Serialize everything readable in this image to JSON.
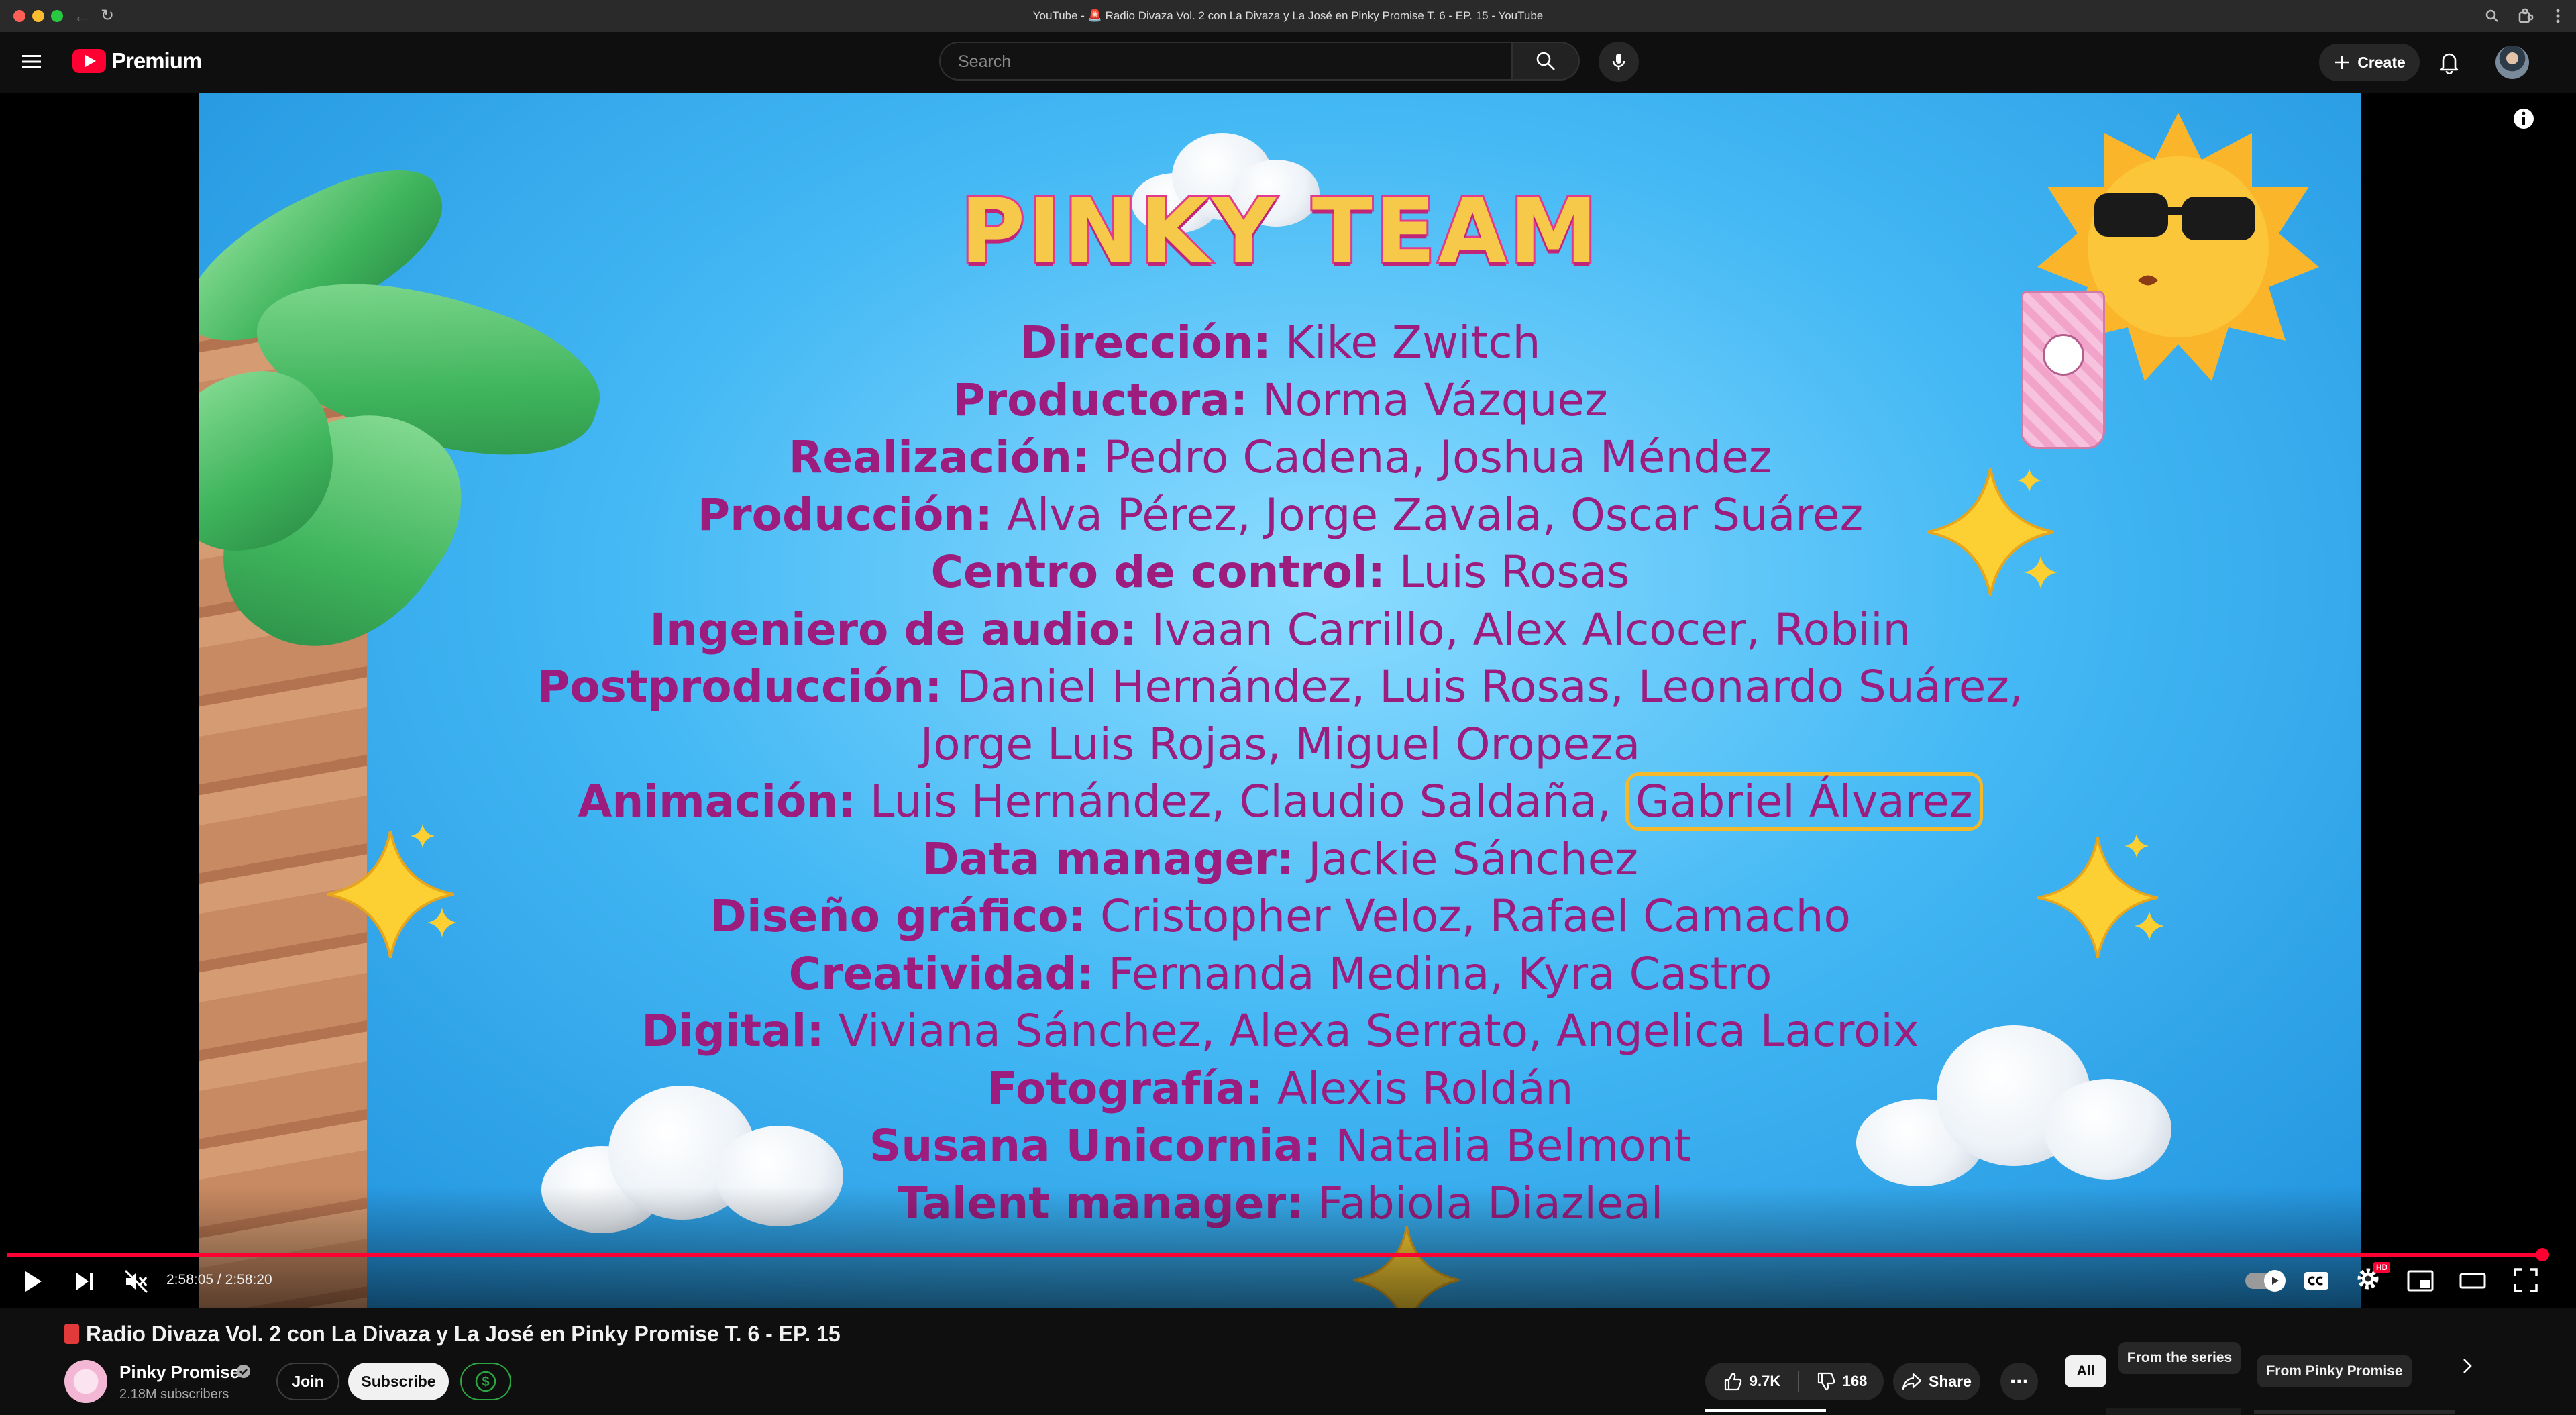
{
  "browser": {
    "window_title": "YouTube - 🚨 Radio Divaza Vol. 2 con La Divaza y La José en Pinky Promise T. 6 - EP. 15 - YouTube",
    "back_glyph": "←",
    "reload_glyph": "↻"
  },
  "header": {
    "logo_text": "Premium",
    "search_placeholder": "Search",
    "create_label": "Create"
  },
  "video": {
    "frame": {
      "title": "PINKY TEAM",
      "credits": [
        {
          "role": "Dirección:",
          "names": "Kike Zwitch"
        },
        {
          "role": "Productora:",
          "names": "Norma Vázquez"
        },
        {
          "role": "Realización:",
          "names": "Pedro Cadena, Joshua Méndez"
        },
        {
          "role": "Producción:",
          "names": "Alva Pérez, Jorge Zavala, Oscar Suárez"
        },
        {
          "role": "Centro de control:",
          "names": "Luis Rosas"
        },
        {
          "role": "Ingeniero de audio:",
          "names": "Ivaan Carrillo, Alex Alcocer, Robiin"
        },
        {
          "role": "Postproducción:",
          "names": "Daniel Hernández, Luis Rosas, Leonardo Suárez,"
        },
        {
          "role": "",
          "names": "Jorge Luis Rojas, Miguel Oropeza"
        },
        {
          "role": "Animación:",
          "names": "Luis Hernández, Claudio Saldaña,",
          "highlighted": "Gabriel Álvarez"
        },
        {
          "role": "Data manager:",
          "names": "Jackie Sánchez"
        },
        {
          "role": "Diseño gráfico:",
          "names": "Cristopher Veloz, Rafael Camacho"
        },
        {
          "role": "Creatividad:",
          "names": "Fernanda Medina, Kyra Castro"
        },
        {
          "role": "Digital:",
          "names": "Viviana Sánchez, Alexa Serrato, Angelica Lacroix"
        },
        {
          "role": "Fotografía:",
          "names": "Alexis Roldán"
        },
        {
          "role": "Susana Unicornia:",
          "names": "Natalia Belmont"
        },
        {
          "role": "Talent manager:",
          "names": "Fabiola Diazleal"
        }
      ]
    },
    "player": {
      "time_display": "2:58:05 / 2:58:20",
      "progress_fraction": 0.9986,
      "hd_badge": "HD",
      "accent_color": "#ff0033"
    },
    "title": "Radio Divaza Vol. 2 con La Divaza y La José en Pinky Promise T. 6 - EP. 15"
  },
  "channel": {
    "name": "Pinky Promise",
    "subscribers": "2.18M subscribers",
    "join_label": "Join",
    "subscribe_label": "Subscribe"
  },
  "actions": {
    "likes": "9.7K",
    "dislikes": "168",
    "share_label": "Share",
    "more_glyph": "⋯"
  },
  "chips": {
    "all": "All",
    "from_series": "From the series",
    "from_channel": "From Pinky Promise"
  },
  "icons": [
    "menu-icon",
    "search-icon",
    "mic-icon",
    "plus-icon",
    "bell-icon",
    "info-icon",
    "play-icon",
    "next-icon",
    "mute-icon",
    "cc-icon",
    "gear-icon",
    "miniplayer-icon",
    "theater-icon",
    "fullscreen-icon",
    "verified-icon",
    "dollar-icon",
    "thumbs-up-icon",
    "thumbs-down-icon",
    "share-icon",
    "chevron-right-icon"
  ]
}
